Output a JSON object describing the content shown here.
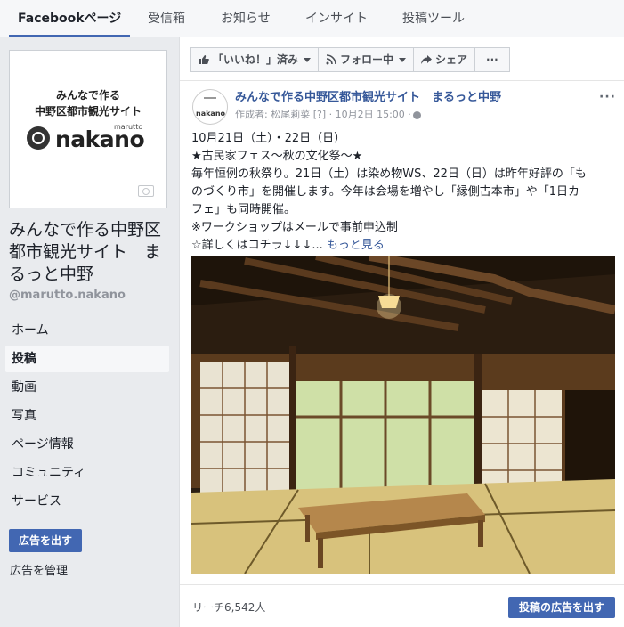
{
  "tabs": [
    "Facebookページ",
    "受信箱",
    "お知らせ",
    "インサイト",
    "投稿ツール"
  ],
  "profile": {
    "line1": "みんなで作る",
    "line2": "中野区都市観光サイト",
    "marutto": "marutto",
    "nakano": "nakano"
  },
  "page": {
    "name": "みんなで作る中野区都市観光サイト　まるっと中野",
    "handle": "@marutto.nakano"
  },
  "nav": [
    "ホーム",
    "投稿",
    "動画",
    "写真",
    "ページ情報",
    "コミュニティ",
    "サービス"
  ],
  "sidebar": {
    "promote_label": "広告を出す",
    "manage_label": "広告を管理"
  },
  "actions": {
    "like_label": "「いいね！」済み",
    "follow_label": "フォロー中",
    "share_label": "シェア",
    "more_label": "···"
  },
  "post": {
    "title": "みんなで作る中野区都市観光サイト　まるっと中野",
    "meta": "作成者: 松尾莉菜 [?] · 10月2日 15:00 ·",
    "lines": [
      "10月21日（土）・22日（日）",
      "★古民家フェス～秋の文化祭～★",
      "毎年恒例の秋祭り。21日（土）は染め物WS、22日（日）は昨年好評の「も",
      "のづくり市」を開催します。今年は会場を増やし「縁側古本市」や「1日カ",
      "フェ」も同時開催。",
      "※ワークショップはメールで事前申込制",
      "☆詳しくはコチラ↓↓↓..."
    ],
    "see_more": "もっと見る",
    "more_icon": "···"
  },
  "footer": {
    "reach": "リーチ6,542人",
    "boost_label": "投稿の広告を出す"
  }
}
